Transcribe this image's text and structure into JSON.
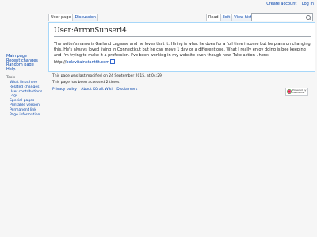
{
  "personal": {
    "create_account": "Create account",
    "log_in": "Log in"
  },
  "ns_tabs": [
    {
      "label": "User page"
    },
    {
      "label": "Discussion"
    }
  ],
  "view_tabs": [
    {
      "label": "Read"
    },
    {
      "label": "Edit"
    },
    {
      "label": "View history"
    }
  ],
  "search": {
    "placeholder": "Search"
  },
  "page": {
    "title": "User:ArronSunseri4",
    "body": "The writer's name is Garland Lagasse and he loves that it. Hiring is what he does for a full time income but he plans on changing this. He's always loved living in Connecticut but he can move 1 day or a different one. What I really enjoy doing is bee keeping and I'm trying to make it a profession. I've been working in my website even though now. Take action . here: http://",
    "link_text": "belavitainstantfit.com"
  },
  "nav": [
    {
      "label": "Main page"
    },
    {
      "label": "Recent changes"
    },
    {
      "label": "Random page"
    },
    {
      "label": "Help"
    }
  ],
  "tools": {
    "heading": "Tools",
    "items": [
      {
        "label": "What links here"
      },
      {
        "label": "Related changes"
      },
      {
        "label": "User contributions"
      },
      {
        "label": "Logs"
      },
      {
        "label": "Special pages"
      },
      {
        "label": "Printable version"
      },
      {
        "label": "Permanent link"
      },
      {
        "label": "Page information"
      }
    ]
  },
  "footer": {
    "last_modified": "This page was last modified on 24 September 2015, at 04:29.",
    "accessed": "This page has been accessed 2 times.",
    "links": [
      "Privacy policy",
      "About KCraft Wiki",
      "Disclaimers"
    ],
    "powered_line1": "Powered by",
    "powered_line2": "MediaWiki"
  },
  "colors": {
    "link": "#0645ad",
    "content_border": "#a7d7f9",
    "background": "#f6f6f6"
  }
}
